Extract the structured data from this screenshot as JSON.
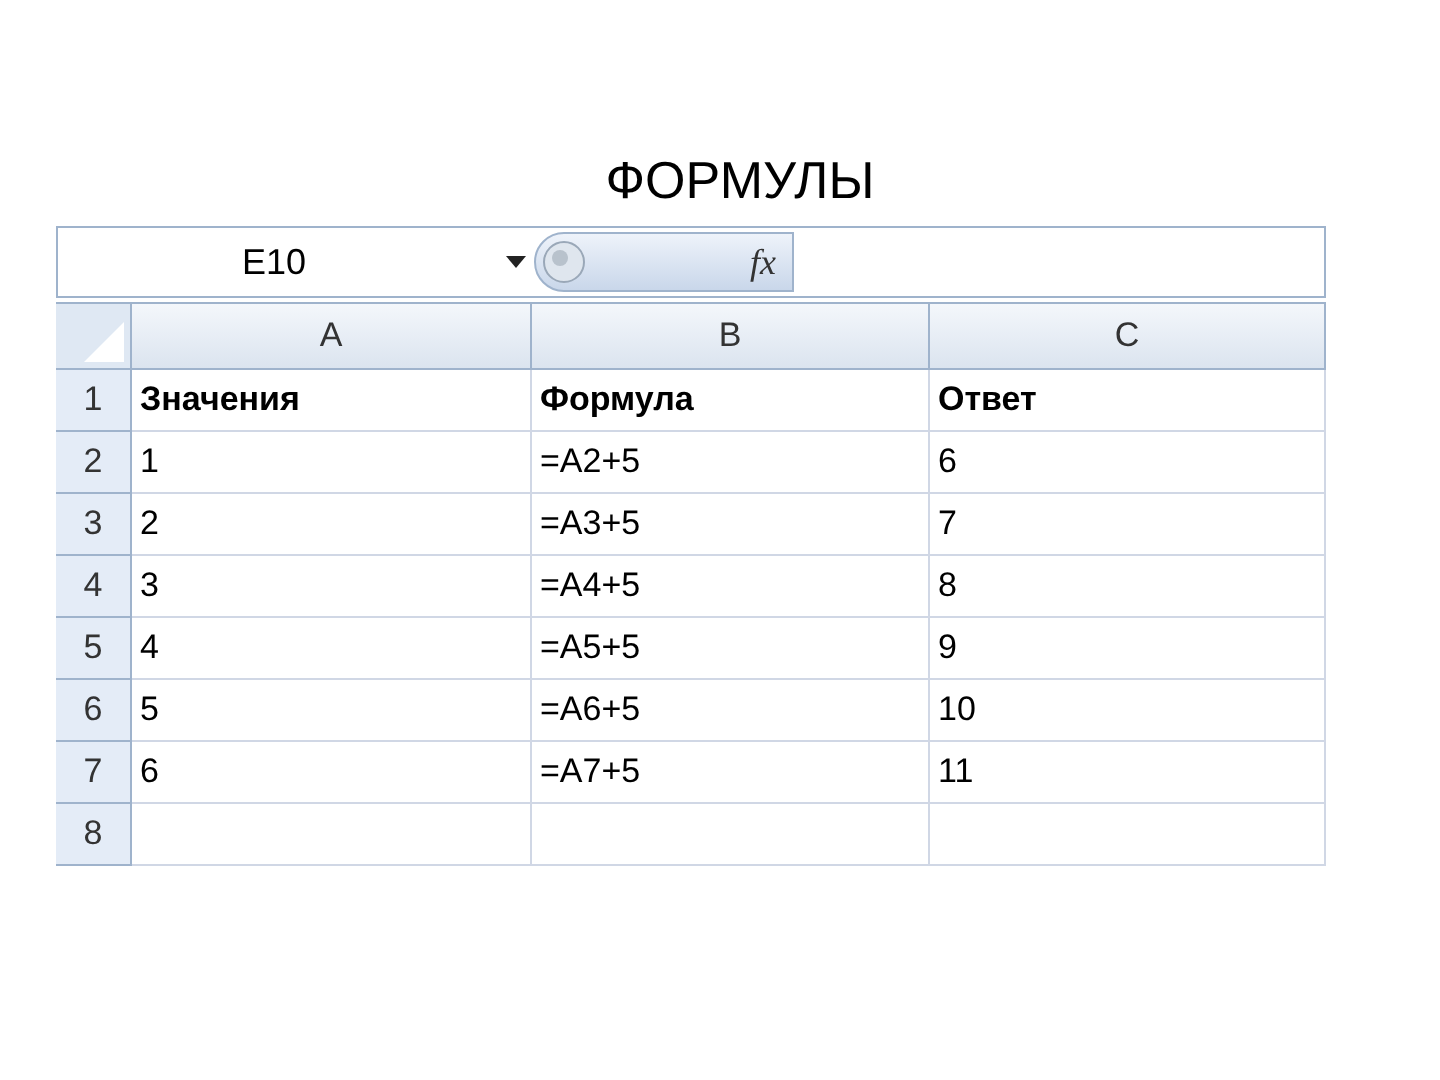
{
  "title": "ФОРМУЛЫ",
  "formula_bar": {
    "name_box": "E10",
    "function_label": "fx"
  },
  "columns": [
    "A",
    "B",
    "C"
  ],
  "rows": [
    {
      "number": "1",
      "kind": "heading",
      "cells": [
        "Значения",
        "Формула",
        "Ответ"
      ]
    },
    {
      "number": "2",
      "kind": "data",
      "cells": [
        "1",
        "=A2+5",
        "6"
      ]
    },
    {
      "number": "3",
      "kind": "data",
      "cells": [
        "2",
        "=A3+5",
        "7"
      ]
    },
    {
      "number": "4",
      "kind": "data",
      "cells": [
        "3",
        "=A4+5",
        "8"
      ]
    },
    {
      "number": "5",
      "kind": "data",
      "cells": [
        "4",
        "=A5+5",
        "9"
      ]
    },
    {
      "number": "6",
      "kind": "data",
      "cells": [
        "5",
        "=A6+5",
        "10"
      ]
    },
    {
      "number": "7",
      "kind": "data",
      "cells": [
        "6",
        "=A7+5",
        "11"
      ]
    },
    {
      "number": "8",
      "kind": "data"
    }
  ]
}
